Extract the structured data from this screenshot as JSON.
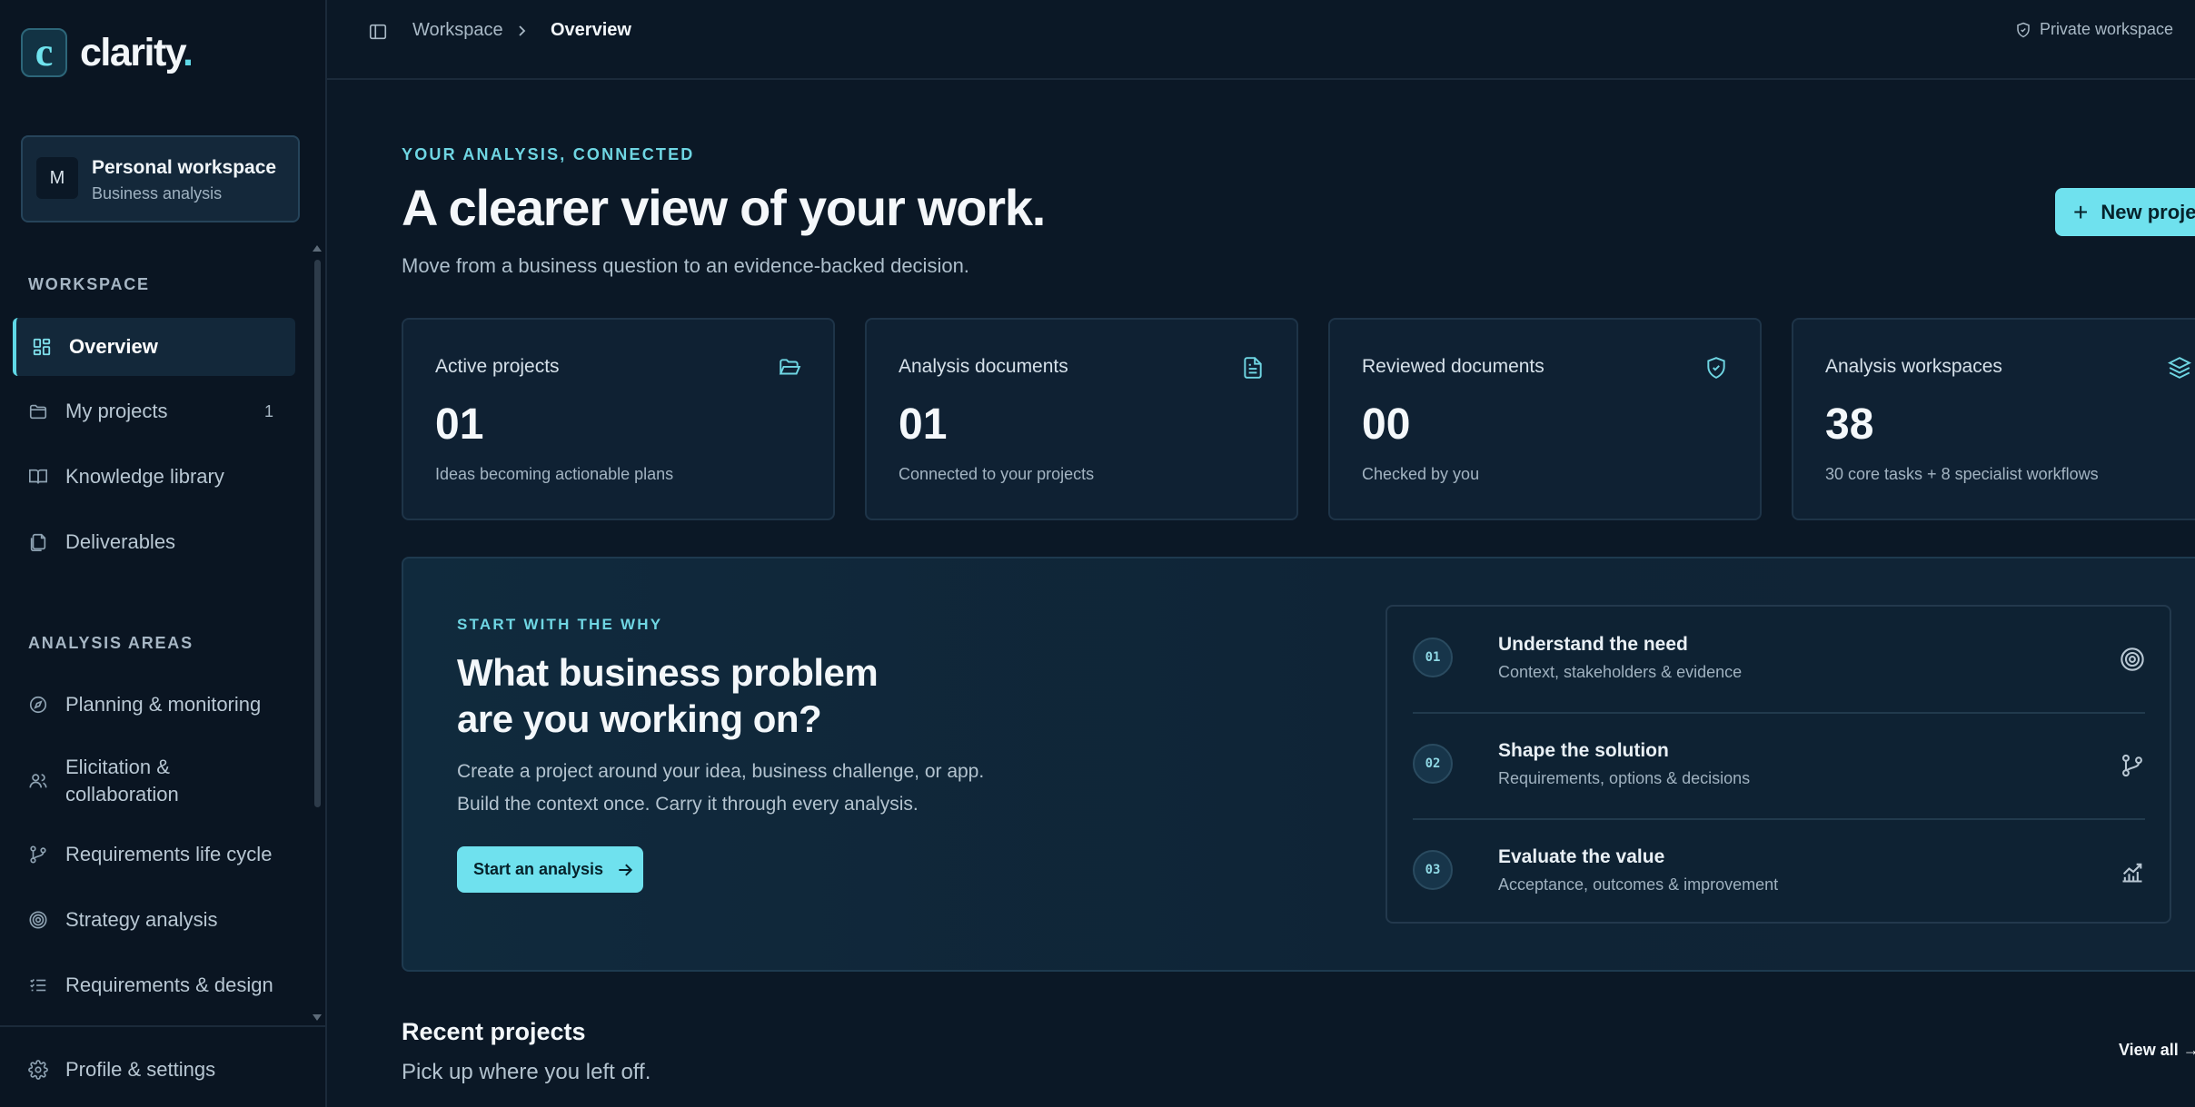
{
  "brand": {
    "logo_letter": "c",
    "name": "clarity",
    "dot": "."
  },
  "workspace": {
    "avatar": "M",
    "name": "Personal workspace",
    "subtitle": "Business analysis"
  },
  "sidebar": {
    "workspace_heading": "WORKSPACE",
    "workspace_items": [
      {
        "label": "Overview",
        "icon": "grid-icon",
        "active": true
      },
      {
        "label": "My projects",
        "icon": "folder-icon",
        "badge": "1"
      },
      {
        "label": "Knowledge library",
        "icon": "book-icon"
      },
      {
        "label": "Deliverables",
        "icon": "files-icon"
      }
    ],
    "areas_heading": "ANALYSIS AREAS",
    "area_items": [
      {
        "label": "Planning & monitoring",
        "icon": "compass-icon"
      },
      {
        "label": "Elicitation & collaboration",
        "label_line1": "Elicitation &",
        "label_line2": "collaboration",
        "icon": "users-icon"
      },
      {
        "label": "Requirements life cycle",
        "icon": "git-branch-icon"
      },
      {
        "label": "Strategy analysis",
        "icon": "target-icon"
      },
      {
        "label": "Requirements & design",
        "icon": "list-checks-icon"
      }
    ],
    "settings_label": "Profile & settings"
  },
  "topbar": {
    "breadcrumb": [
      "Workspace",
      "Overview"
    ],
    "privacy_label": "Private workspace"
  },
  "header": {
    "eyebrow": "YOUR ANALYSIS, CONNECTED",
    "title": "A clearer view of your work.",
    "subtitle": "Move from a business question to an evidence-backed decision.",
    "new_button": "New project"
  },
  "stats": [
    {
      "label": "Active projects",
      "value": "01",
      "caption": "Ideas becoming actionable plans",
      "icon": "folder-open-icon"
    },
    {
      "label": "Analysis documents",
      "value": "01",
      "caption": "Connected to your projects",
      "icon": "document-icon"
    },
    {
      "label": "Reviewed documents",
      "value": "00",
      "caption": "Checked by you",
      "icon": "shield-check-icon"
    },
    {
      "label": "Analysis workspaces",
      "value": "38",
      "caption": "30 core tasks + 8 specialist workflows",
      "icon": "layers-icon"
    }
  ],
  "hero": {
    "eyebrow": "START WITH THE WHY",
    "title_line1": "What business problem",
    "title_line2": "are you working on?",
    "text_line1": "Create a project around your idea, business challenge, or app.",
    "text_line2": "Build the context once. Carry it through every analysis.",
    "button": "Start an analysis"
  },
  "steps": [
    {
      "num": "01",
      "title": "Understand the need",
      "subtitle": "Context, stakeholders & evidence",
      "icon": "target-icon"
    },
    {
      "num": "02",
      "title": "Shape the solution",
      "subtitle": "Requirements, options & decisions",
      "icon": "git-branch-icon"
    },
    {
      "num": "03",
      "title": "Evaluate the value",
      "subtitle": "Acceptance, outcomes & improvement",
      "icon": "chart-trend-icon"
    }
  ],
  "recent": {
    "title": "Recent projects",
    "subtitle": "Pick up where you left off.",
    "view_all": "View all"
  },
  "colors": {
    "accent": "#6fe1ee",
    "background": "#0b1826",
    "sidebar": "#0a1522",
    "card": "#0f2133"
  }
}
